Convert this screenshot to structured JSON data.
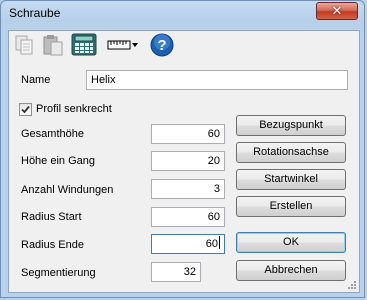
{
  "window": {
    "title": "Schraube",
    "close_symbol": "✕"
  },
  "toolbar": {
    "icons": [
      "copy-icon",
      "paste-icon",
      "calculator-icon",
      "ruler-dropdown-icon",
      "help-icon"
    ],
    "help_symbol": "?"
  },
  "form": {
    "name_label": "Name",
    "name_value": "Helix",
    "profil_label": "Profil senkrecht",
    "profil_checked": true,
    "fields": [
      {
        "label": "Gesamthöhe",
        "value": "60"
      },
      {
        "label": "Höhe ein Gang",
        "value": "20"
      },
      {
        "label": "Anzahl Windungen",
        "value": "3"
      },
      {
        "label": "Radius Start",
        "value": "60"
      },
      {
        "label": "Radius Ende",
        "value": "60"
      },
      {
        "label": "Segmentierung",
        "value": "32"
      }
    ]
  },
  "buttons": {
    "bezugspunkt": "Bezugspunkt",
    "rotationsachse": "Rotationsachse",
    "startwinkel": "Startwinkel",
    "erstellen": "Erstellen",
    "ok": "OK",
    "abbrechen": "Abbrechen"
  },
  "colors": {
    "accent": "#3c7fb1",
    "close": "#c03c23",
    "help": "#1a5fb4"
  }
}
